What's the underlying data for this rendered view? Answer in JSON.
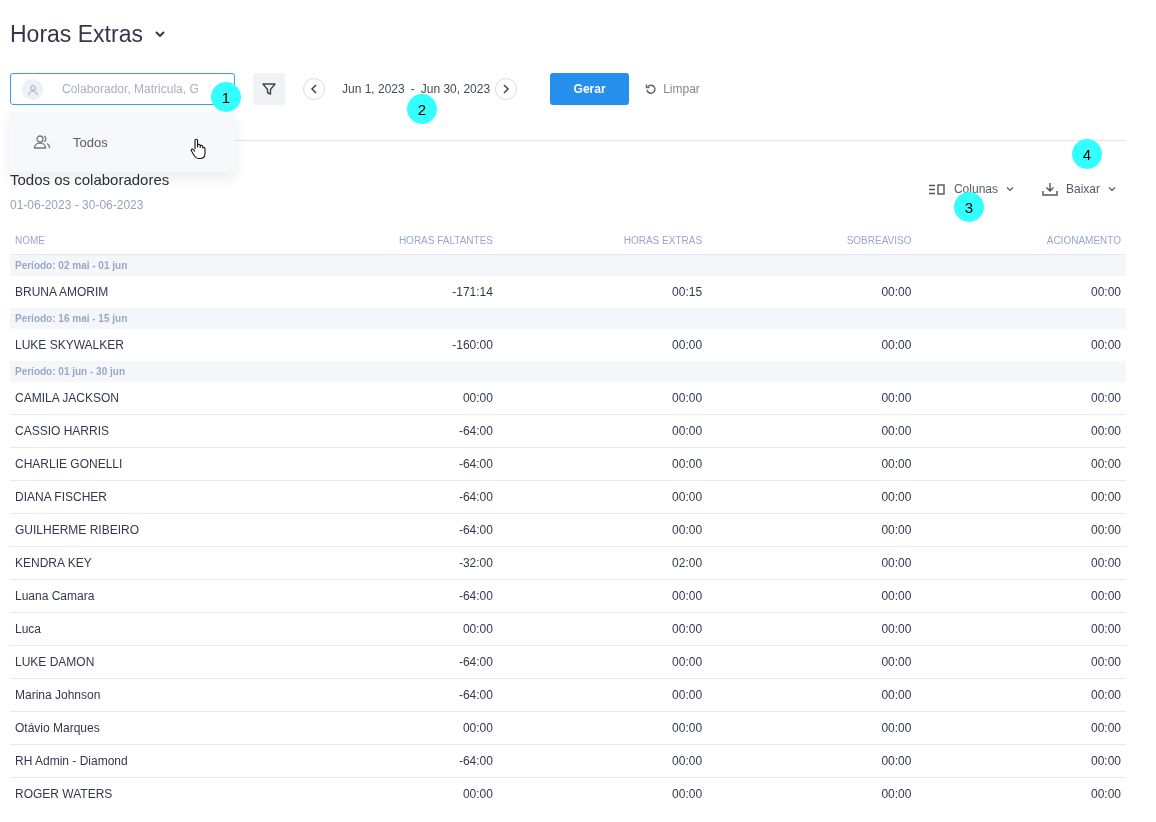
{
  "page": {
    "title": "Horas Extras"
  },
  "toolbar": {
    "search_placeholder": "Colaborador, Matricula, G",
    "date_start": "Jun 1, 2023",
    "date_separator": "-",
    "date_end": "Jun 30, 2023",
    "generate_button": "Gerar",
    "clear_button": "Limpar"
  },
  "dropdown": {
    "items": [
      {
        "label": "Todos"
      }
    ]
  },
  "report": {
    "title": "Todos os colaboradores",
    "subtitle": "01-06-2023 - 30-06-2023",
    "columns_button": "Colunas",
    "download_button": "Baixar"
  },
  "table": {
    "columns": [
      "NOME",
      "HORAS FALTANTES",
      "HORAS EXTRAS",
      "SOBREAVISO",
      "ACIONAMENTO"
    ],
    "groups": [
      {
        "period": "Período: 02 mai - 01 jun",
        "rows": [
          [
            "BRUNA AMORIM",
            "-171:14",
            "00:15",
            "00:00",
            "00:00"
          ]
        ]
      },
      {
        "period": "Período: 16 mai - 15 jun",
        "rows": [
          [
            "LUKE SKYWALKER",
            "-160:00",
            "00:00",
            "00:00",
            "00:00"
          ]
        ]
      },
      {
        "period": "Período: 01 jun - 30 jun",
        "rows": [
          [
            "CAMILA JACKSON",
            "00:00",
            "00:00",
            "00:00",
            "00:00"
          ],
          [
            "CASSIO HARRIS",
            "-64:00",
            "00:00",
            "00:00",
            "00:00"
          ],
          [
            "CHARLIE GONELLI",
            "-64:00",
            "00:00",
            "00:00",
            "00:00"
          ],
          [
            "DIANA FISCHER",
            "-64:00",
            "00:00",
            "00:00",
            "00:00"
          ],
          [
            "GUILHERME RIBEIRO",
            "-64:00",
            "00:00",
            "00:00",
            "00:00"
          ],
          [
            "KENDRA KEY",
            "-32:00",
            "02:00",
            "00:00",
            "00:00"
          ],
          [
            "Luana Camara",
            "-64:00",
            "00:00",
            "00:00",
            "00:00"
          ],
          [
            "Luca",
            "00:00",
            "00:00",
            "00:00",
            "00:00"
          ],
          [
            "LUKE DAMON",
            "-64:00",
            "00:00",
            "00:00",
            "00:00"
          ],
          [
            "Marina Johnson",
            "-64:00",
            "00:00",
            "00:00",
            "00:00"
          ],
          [
            "Otávio Marques",
            "00:00",
            "00:00",
            "00:00",
            "00:00"
          ],
          [
            "RH Admin - Diamond",
            "-64:00",
            "00:00",
            "00:00",
            "00:00"
          ],
          [
            "ROGER WATERS",
            "00:00",
            "00:00",
            "00:00",
            "00:00"
          ]
        ]
      }
    ]
  },
  "callouts": [
    "1",
    "2",
    "3",
    "4"
  ]
}
